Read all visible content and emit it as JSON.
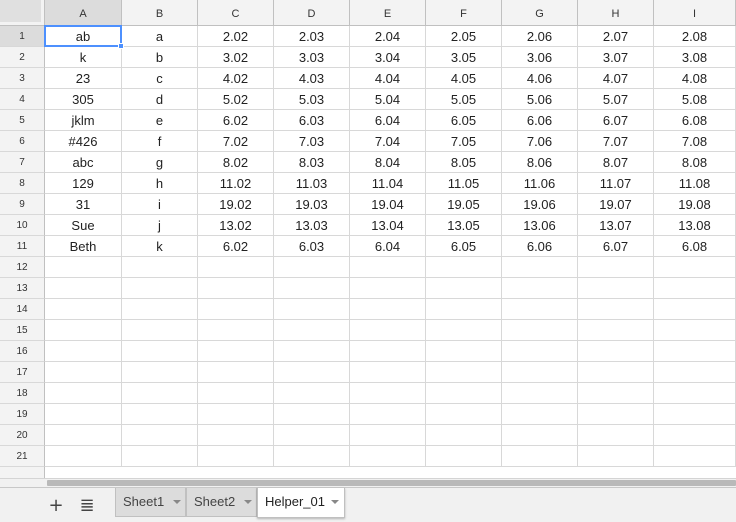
{
  "spreadsheet": {
    "columns": [
      "A",
      "B",
      "C",
      "D",
      "E",
      "F",
      "G",
      "H",
      "I"
    ],
    "row_numbers": [
      "1",
      "2",
      "3",
      "4",
      "5",
      "6",
      "7",
      "8",
      "9",
      "10",
      "11",
      "12",
      "13",
      "14",
      "15",
      "16",
      "17",
      "18",
      "19",
      "20",
      "21"
    ],
    "selected_cell": "A1",
    "rows": [
      [
        "ab",
        "a",
        "2.02",
        "2.03",
        "2.04",
        "2.05",
        "2.06",
        "2.07",
        "2.08"
      ],
      [
        "k",
        "b",
        "3.02",
        "3.03",
        "3.04",
        "3.05",
        "3.06",
        "3.07",
        "3.08"
      ],
      [
        "23",
        "c",
        "4.02",
        "4.03",
        "4.04",
        "4.05",
        "4.06",
        "4.07",
        "4.08"
      ],
      [
        "305",
        "d",
        "5.02",
        "5.03",
        "5.04",
        "5.05",
        "5.06",
        "5.07",
        "5.08"
      ],
      [
        "jklm",
        "e",
        "6.02",
        "6.03",
        "6.04",
        "6.05",
        "6.06",
        "6.07",
        "6.08"
      ],
      [
        "#426",
        "f",
        "7.02",
        "7.03",
        "7.04",
        "7.05",
        "7.06",
        "7.07",
        "7.08"
      ],
      [
        "abc",
        "g",
        "8.02",
        "8.03",
        "8.04",
        "8.05",
        "8.06",
        "8.07",
        "8.08"
      ],
      [
        "129",
        "h",
        "11.02",
        "11.03",
        "11.04",
        "11.05",
        "11.06",
        "11.07",
        "11.08"
      ],
      [
        "31",
        "i",
        "19.02",
        "19.03",
        "19.04",
        "19.05",
        "19.06",
        "19.07",
        "19.08"
      ],
      [
        "Sue",
        "j",
        "13.02",
        "13.03",
        "13.04",
        "13.05",
        "13.06",
        "13.07",
        "13.08"
      ],
      [
        "Beth",
        "k",
        "6.02",
        "6.03",
        "6.04",
        "6.05",
        "6.06",
        "6.07",
        "6.08"
      ]
    ]
  },
  "bottom_bar": {
    "add_sheet_icon": "plus-icon",
    "add_sheet_glyph": "+",
    "all_sheets_icon": "list-icon",
    "all_sheets_glyph": "≣",
    "tabs": [
      {
        "label": "Sheet1",
        "active": false
      },
      {
        "label": "Sheet2",
        "active": false
      },
      {
        "label": "Helper_01",
        "active": true
      }
    ]
  },
  "colors": {
    "selection": "#4d90fe",
    "header_bg": "#f3f3f3",
    "active_header_bg": "#dcdcdc",
    "gridline": "#d8d8d8"
  }
}
